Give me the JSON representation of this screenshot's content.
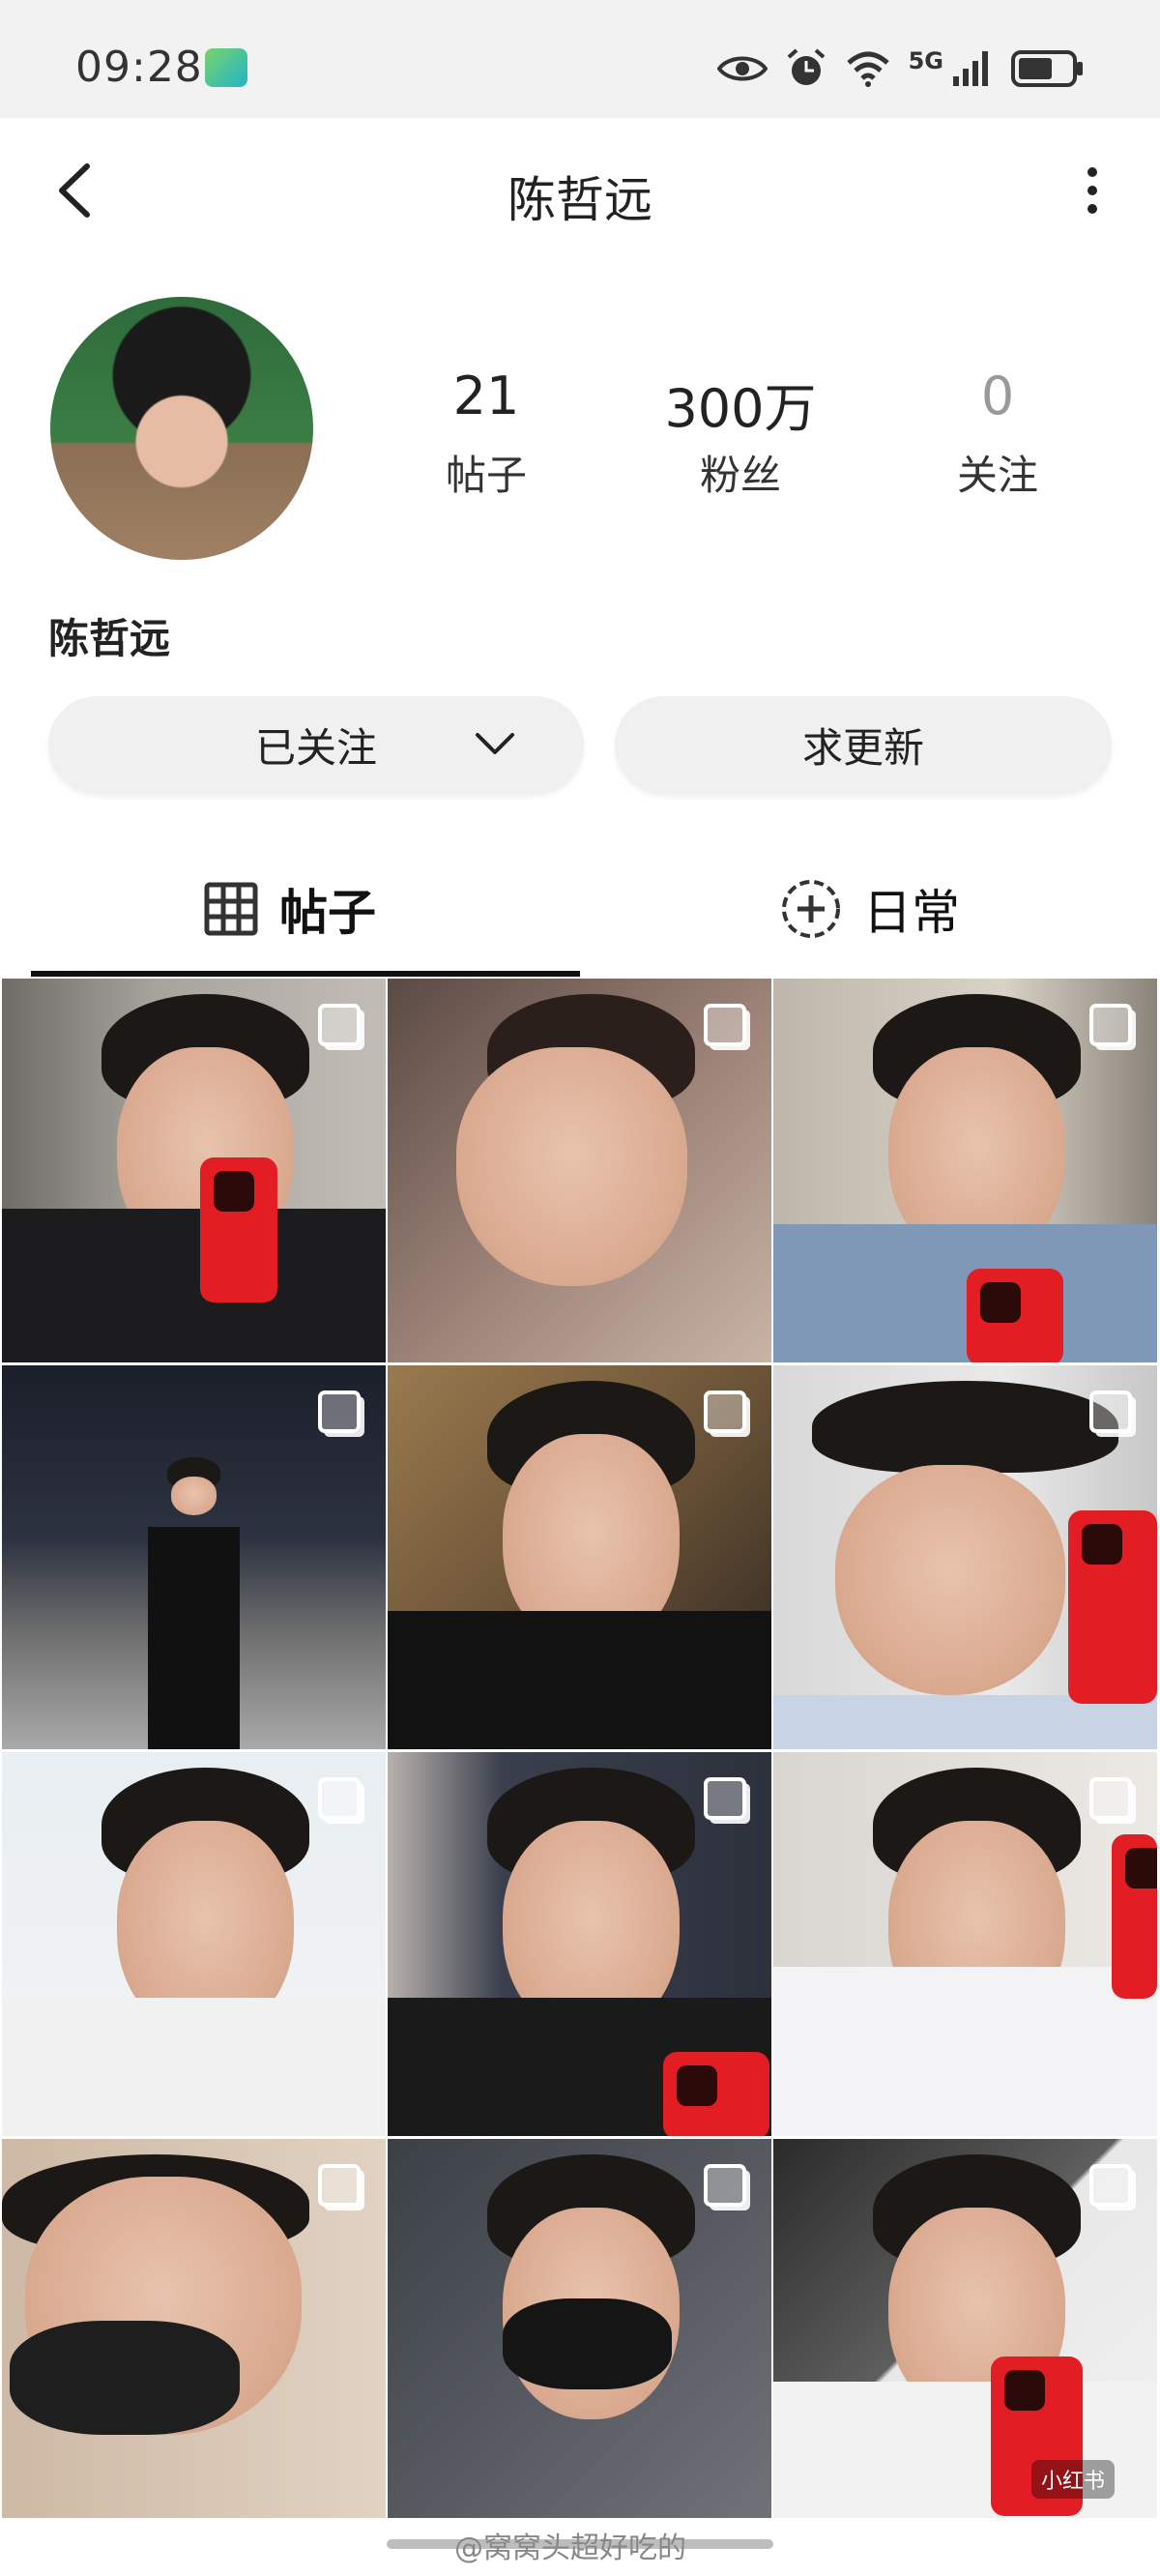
{
  "status_bar": {
    "time": "09:28",
    "network": "5G",
    "icons": [
      "eye-icon",
      "alarm-icon",
      "wifi-icon",
      "signal-icon",
      "battery-icon"
    ]
  },
  "header": {
    "title": "陈哲远",
    "back_icon": "chevron-left-icon",
    "more_icon": "more-vertical-icon"
  },
  "profile": {
    "name": "陈哲远",
    "stats": [
      {
        "value": "21",
        "label": "帖子"
      },
      {
        "value": "300万",
        "label": "粉丝"
      },
      {
        "value": "0",
        "label": "关注"
      }
    ]
  },
  "actions": {
    "follow_label": "已关注",
    "request_update_label": "求更新"
  },
  "tabs": [
    {
      "label": "帖子",
      "icon": "grid-icon",
      "active": true
    },
    {
      "label": "日常",
      "icon": "add-circle-icon",
      "active": false
    }
  ],
  "grid": {
    "tile_count": 12,
    "multi_image_icon": "multi-image-icon",
    "corner_logo": "小红书"
  },
  "watermark": "@窝窝头超好吃的",
  "colors": {
    "background": "#ffffff",
    "status_bar": "#f2f2f2",
    "button_bg": "#f0f0f0",
    "tab_underline": "#111111",
    "phone_red": "#e21d23"
  }
}
